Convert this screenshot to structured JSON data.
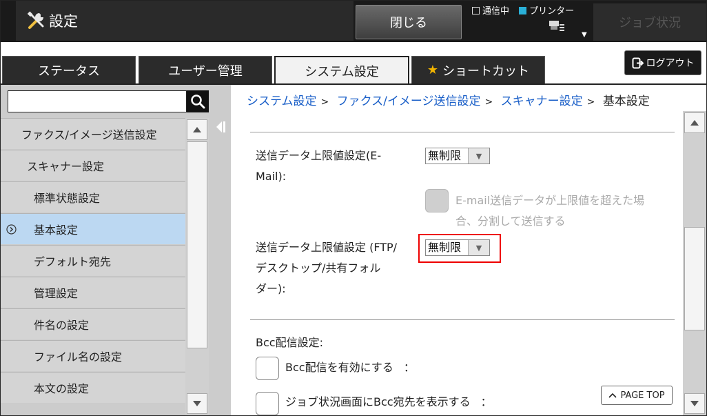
{
  "header": {
    "title": "設定",
    "close_label": "閉じる",
    "status_comm": "通信中",
    "status_printer": "プリンター",
    "job_status_label": "ジョブ状況"
  },
  "tabs": [
    {
      "label": "ステータス",
      "active": false
    },
    {
      "label": "ユーザー管理",
      "active": false
    },
    {
      "label": "システム設定",
      "active": true
    },
    {
      "label": "ショートカット",
      "active": false
    }
  ],
  "logout_label": "ログアウト",
  "search": {
    "value": "",
    "placeholder": ""
  },
  "sidebar": {
    "items": [
      {
        "label": "ファクス/イメージ送信設定",
        "selected": false
      },
      {
        "label": "スキャナー設定",
        "selected": false
      },
      {
        "label": "標準状態設定",
        "selected": false
      },
      {
        "label": "基本設定",
        "selected": true
      },
      {
        "label": "デフォルト宛先",
        "selected": false
      },
      {
        "label": "管理設定",
        "selected": false
      },
      {
        "label": "件名の設定",
        "selected": false
      },
      {
        "label": "ファイル名の設定",
        "selected": false
      },
      {
        "label": "本文の設定",
        "selected": false
      }
    ]
  },
  "breadcrumb": {
    "items": [
      "システム設定",
      "ファクス/イメージ送信設定",
      "スキャナー設定"
    ],
    "current": "基本設定",
    "separator": ">"
  },
  "settings": {
    "email_limit_label_1": "送信データ上限値設定(E-",
    "email_limit_label_2": "Mail):",
    "email_limit_value": "無制限",
    "email_split_text_1": "E-mail送信データが上限値を超えた場",
    "email_split_text_2": "合、分割して送信する",
    "ftp_limit_label_1": "送信データ上限値設定 (FTP/",
    "ftp_limit_label_2": "デスクトップ/共有フォル",
    "ftp_limit_label_3": "ダー):",
    "ftp_limit_value": "無制限",
    "bcc_heading": "Bcc配信設定:",
    "bcc_enable_label": "Bcc配信を有効にする",
    "bcc_show_label": "ジョブ状況画面にBcc宛先を表示する",
    "colon": "："
  },
  "page_top_label": "PAGE TOP",
  "colors": {
    "accent_link": "#1a5fc8",
    "selected_row": "#bcd8f2",
    "highlight_box": "#e00000",
    "star": "#f2b400"
  }
}
